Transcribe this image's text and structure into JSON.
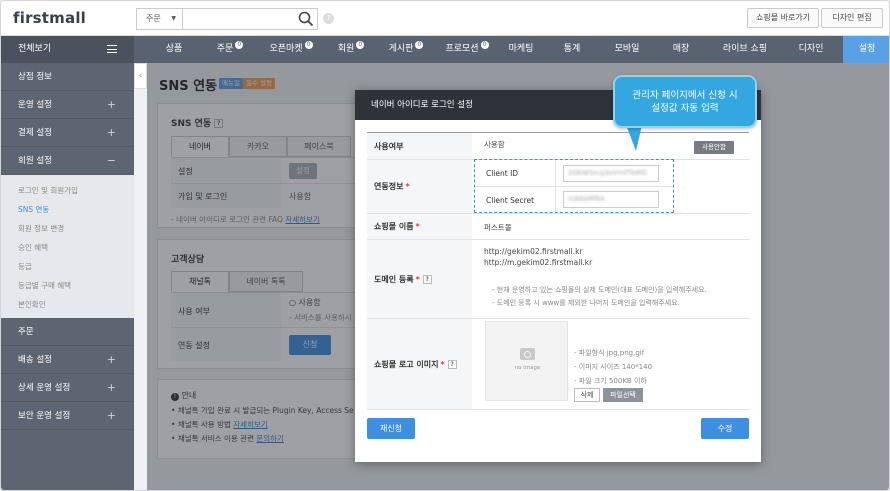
{
  "header": {
    "logo": "firstmall",
    "search_select": "주문",
    "search_placeholder": "",
    "help": "?",
    "shop_btn": "쇼핑몰 바로가기",
    "design_btn": "디자인 편집"
  },
  "nav": {
    "all": "전체보기",
    "items": [
      {
        "label": "상품",
        "badge": ""
      },
      {
        "label": "주문",
        "badge": "0"
      },
      {
        "label": "오픈마켓",
        "badge": "0"
      },
      {
        "label": "회원",
        "badge": "0"
      },
      {
        "label": "게시판",
        "badge": "0"
      },
      {
        "label": "프로모션",
        "badge": "0"
      },
      {
        "label": "마케팅",
        "badge": ""
      },
      {
        "label": "통계",
        "badge": ""
      },
      {
        "label": "모바일",
        "badge": ""
      },
      {
        "label": "매장",
        "badge": ""
      },
      {
        "label": "라이브 쇼핑",
        "badge": ""
      },
      {
        "label": "디자인",
        "badge": ""
      },
      {
        "label": "설정",
        "badge": ""
      }
    ]
  },
  "sidebar": {
    "sections": [
      "상점 정보",
      "운영 설정",
      "결제 설정",
      "회원 설정"
    ],
    "sub_items": [
      "로그인 및 회원가입",
      "SNS 연동",
      "회원 정보 변경",
      "승인 혜택",
      "등급",
      "등급별 구매 혜택",
      "본인확인"
    ],
    "sections_after": [
      "주문",
      "배송 설정",
      "상세 운영 설정",
      "보안 운영 설정"
    ]
  },
  "main": {
    "title": "SNS 연동",
    "tag_manual": "매뉴얼",
    "tag_required": "필수 설정",
    "sns": {
      "title": "SNS 연동",
      "tabs": [
        "네이버",
        "카카오",
        "페이스북"
      ],
      "setting_label": "설정",
      "setting_btn": "설정",
      "login_label": "가입 및 로그인",
      "login_value": "사용함",
      "faq_note": "- 네이버 아이디로 로그인 관련 FAQ",
      "faq_link": "자세히보기"
    },
    "consult": {
      "title": "고객상담",
      "tabs": [
        "채널톡",
        "네이버 톡톡"
      ],
      "use_label": "사용 여부",
      "use_option": "사용함",
      "use_note": "- 서비스를 사용하시",
      "link_label": "연동 설정",
      "link_btn": "신청"
    },
    "info": {
      "title": "안내",
      "line1": "채널톡 가입 완료 시 발급되는 Plugin Key, Access Se",
      "line2": "채널톡 사용 방법",
      "line2_link": "자세히보기",
      "line3": "채널톡 서비스 이용 관련",
      "line3_link": "문의하기"
    }
  },
  "modal": {
    "title": "네이버 아이디로 로그인 설정",
    "use_label": "사용여부",
    "use_value": "사용함",
    "applied_btn": "사용안함",
    "link_label": "연동정보",
    "client_id_label": "Client ID",
    "client_id_value": "2OkWSeuJ3oVmfTbMG",
    "client_secret_label": "Client Secret",
    "client_secret_value": "rUkkkMfbk",
    "shop_name_label": "쇼핑몰 이름",
    "shop_name_value": "퍼스트몰",
    "domain_label": "도메인 등록",
    "domain1": "http://gekim02.firstmall.kr",
    "domain2": "http://m.gekim02.firstmall.kr",
    "domain_note1": "- 현재 운영하고 있는 쇼핑몰의 실제 도메인(대표 도메인)을 입력해주세요.",
    "domain_note2": "- 도메인 등록 시 www를 제외한 나머지 도메인을 입력해주세요.",
    "logo_label": "쇼핑몰 로고 이미지",
    "no_image": "no image",
    "logo_note1": "- 파일형식 jpg,png,gif",
    "logo_note2": "- 이미지 사이즈 140*140",
    "logo_note3": "- 파일 크기 500KB 이하",
    "delete_btn": "삭제",
    "file_btn": "파일선택",
    "reapply_btn": "재신청",
    "edit_btn": "수정"
  },
  "tooltip": {
    "line1": "관리자 페이지에서 신청 시",
    "line2": "설정값 자동 입력"
  },
  "colors": {
    "accent": "#3d8fe0",
    "nav_bg": "#596270",
    "tooltip": "#35a7e0"
  }
}
